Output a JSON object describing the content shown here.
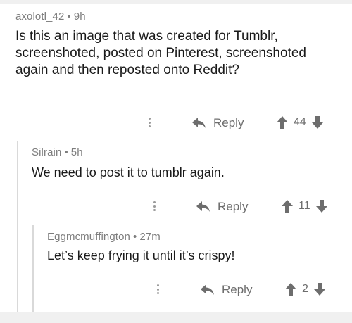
{
  "comments": [
    {
      "username": "axolotl_42",
      "separator": "•",
      "age": "9h",
      "text": "Is this an image that was created for Tumblr, screenshoted, posted on Pinterest, screenshoted again and then reposted onto Reddit?",
      "reply_label": "Reply",
      "score": "44"
    },
    {
      "username": "Silrain",
      "separator": "•",
      "age": "5h",
      "text": "We need to post it to tumblr again.",
      "reply_label": "Reply",
      "score": "11"
    },
    {
      "username": "Eggmcmuffington",
      "separator": "•",
      "age": "27m",
      "text": "Let’s keep frying it until it’s crispy!",
      "reply_label": "Reply",
      "score": "2"
    }
  ],
  "icons": {
    "more": "more-vertical-icon",
    "reply": "reply-arrow-icon",
    "upvote": "upvote-arrow-icon",
    "downvote": "downvote-arrow-icon"
  },
  "colors": {
    "background": "#f0f0f0",
    "card": "#ffffff",
    "meta_text": "#7d7d7d",
    "body_text": "#1a1a1a",
    "rail": "#d9d9d9"
  }
}
